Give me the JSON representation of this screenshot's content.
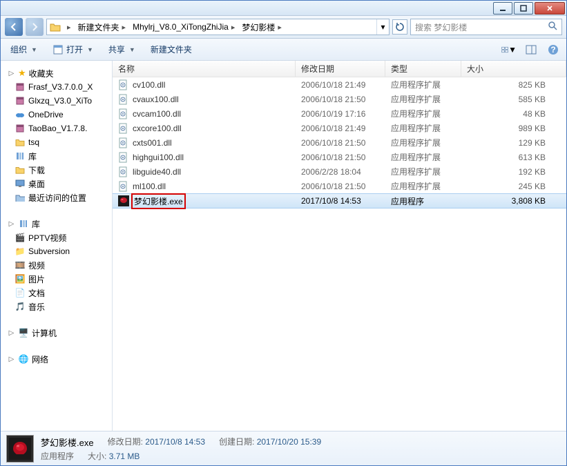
{
  "titlebar": {},
  "address": {
    "crumbs": [
      "新建文件夹",
      "Mhylrj_V8.0_XiTongZhiJia",
      "梦幻影楼"
    ],
    "search_placeholder": "搜索 梦幻影楼"
  },
  "toolbar": {
    "organize": "组织",
    "open": "打开",
    "share": "共享",
    "newfolder": "新建文件夹"
  },
  "sidebar": {
    "favorites": "收藏夹",
    "fav_items": [
      "Frasf_V3.7.0.0_X",
      "Glxzq_V3.0_XiTo",
      "OneDrive",
      "TaoBao_V1.7.8.",
      "tsq"
    ],
    "libraries": "库",
    "downloads": "下载",
    "desktop": "桌面",
    "recent": "最近访问的位置",
    "lib2": "库",
    "lib_items": [
      "PPTV视频",
      "Subversion",
      "视频",
      "图片",
      "文档",
      "音乐"
    ],
    "computer": "计算机",
    "network": "网络"
  },
  "columns": {
    "name": "名称",
    "date": "修改日期",
    "type": "类型",
    "size": "大小"
  },
  "files": [
    {
      "name": "cv100.dll",
      "date": "2006/10/18 21:49",
      "type": "应用程序扩展",
      "size": "825 KB",
      "icon": "dll"
    },
    {
      "name": "cvaux100.dll",
      "date": "2006/10/18 21:50",
      "type": "应用程序扩展",
      "size": "585 KB",
      "icon": "dll"
    },
    {
      "name": "cvcam100.dll",
      "date": "2006/10/19 17:16",
      "type": "应用程序扩展",
      "size": "48 KB",
      "icon": "dll"
    },
    {
      "name": "cxcore100.dll",
      "date": "2006/10/18 21:49",
      "type": "应用程序扩展",
      "size": "989 KB",
      "icon": "dll"
    },
    {
      "name": "cxts001.dll",
      "date": "2006/10/18 21:50",
      "type": "应用程序扩展",
      "size": "129 KB",
      "icon": "dll"
    },
    {
      "name": "highgui100.dll",
      "date": "2006/10/18 21:50",
      "type": "应用程序扩展",
      "size": "613 KB",
      "icon": "dll"
    },
    {
      "name": "libguide40.dll",
      "date": "2006/2/28 18:04",
      "type": "应用程序扩展",
      "size": "192 KB",
      "icon": "dll"
    },
    {
      "name": "ml100.dll",
      "date": "2006/10/18 21:50",
      "type": "应用程序扩展",
      "size": "245 KB",
      "icon": "dll"
    },
    {
      "name": "梦幻影楼.exe",
      "date": "2017/10/8 14:53",
      "type": "应用程序",
      "size": "3,808 KB",
      "icon": "exe",
      "selected": true,
      "highlight": true
    }
  ],
  "status": {
    "filename": "梦幻影楼.exe",
    "filetype": "应用程序",
    "moddate_label": "修改日期:",
    "moddate": "2017/10/8 14:53",
    "created_label": "创建日期:",
    "created": "2017/10/20 15:39",
    "size_label": "大小:",
    "size": "3.71 MB"
  }
}
